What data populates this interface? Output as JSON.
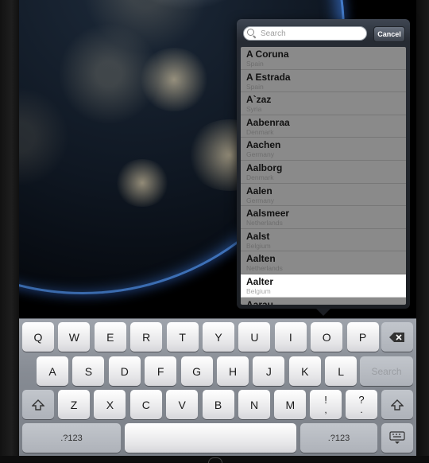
{
  "search": {
    "placeholder": "Search",
    "cancel_label": "Cancel"
  },
  "results": [
    {
      "city": "A Coruna",
      "country": "Spain"
    },
    {
      "city": "A Estrada",
      "country": "Spain"
    },
    {
      "city": "A`zaz",
      "country": "Syria"
    },
    {
      "city": "Aabenraa",
      "country": "Denmark"
    },
    {
      "city": "Aachen",
      "country": "Germany"
    },
    {
      "city": "Aalborg",
      "country": "Denmark"
    },
    {
      "city": "Aalen",
      "country": "Germany"
    },
    {
      "city": "Aalsmeer",
      "country": "Netherlands"
    },
    {
      "city": "Aalst",
      "country": "Belgium"
    },
    {
      "city": "Aalten",
      "country": "Netherlands"
    },
    {
      "city": "Aalter",
      "country": "Belgium"
    },
    {
      "city": "Aarau",
      "country": ""
    }
  ],
  "keyboard": {
    "row1": [
      "Q",
      "W",
      "E",
      "R",
      "T",
      "Y",
      "U",
      "I",
      "O",
      "P"
    ],
    "row2": [
      "A",
      "S",
      "D",
      "F",
      "G",
      "H",
      "J",
      "K",
      "L"
    ],
    "row3": [
      "Z",
      "X",
      "C",
      "V",
      "B",
      "N",
      "M"
    ],
    "search_key": "Search",
    "numbers_key": ".?123",
    "punct1_top": "!",
    "punct1_bottom": ",",
    "punct2_top": "?",
    "punct2_bottom": ".",
    "icons": {
      "backspace": "backspace-icon",
      "shift": "shift-icon",
      "hide_keyboard": "keyboard-dismiss-icon"
    }
  },
  "colors": {
    "popover": "#262b33",
    "results_bg": "#8a8a8a",
    "keyboard_bg": "#868b93"
  }
}
